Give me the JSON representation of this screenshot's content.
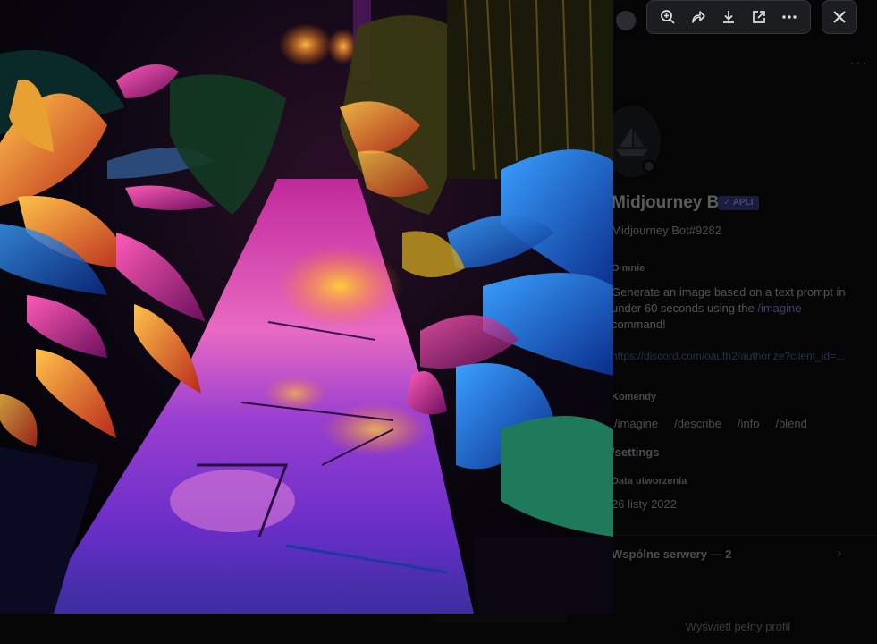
{
  "profile": {
    "more_label": "···",
    "display_name": "Midjourney Bot",
    "app_badge": "✓ APLI",
    "username": "Midjourney Bot#9282",
    "about_title": "O mnie",
    "about_text_1": "Generate an image based on a text prompt in under 60 seconds using the ",
    "about_cmd": "/imagine",
    "about_text_2": " command!",
    "link": "https://discord.com/oauth2/authorize?client_id=...",
    "commands_title": "Komendy",
    "commands": [
      "/imagine",
      "/describe",
      "/info",
      "/blend"
    ],
    "settings": "/settings",
    "created_title": "Data utworzenia",
    "created_value": "26 listy 2022",
    "servers": "Wspólne serwery — 2",
    "full_profile": "Wyświetl pełny profil"
  },
  "image": {
    "alt": "Neon lit garden path at night with glowing leaves"
  },
  "toolbar": {
    "zoom_icon": "zoom-in-icon",
    "forward_icon": "forward-icon",
    "download_icon": "download-icon",
    "open_icon": "open-external-icon",
    "more_icon": "more-icon",
    "close_icon": "close-icon"
  },
  "colors": {
    "toolbar_bg": "#1c1d21",
    "accent": "#8c92e6"
  }
}
